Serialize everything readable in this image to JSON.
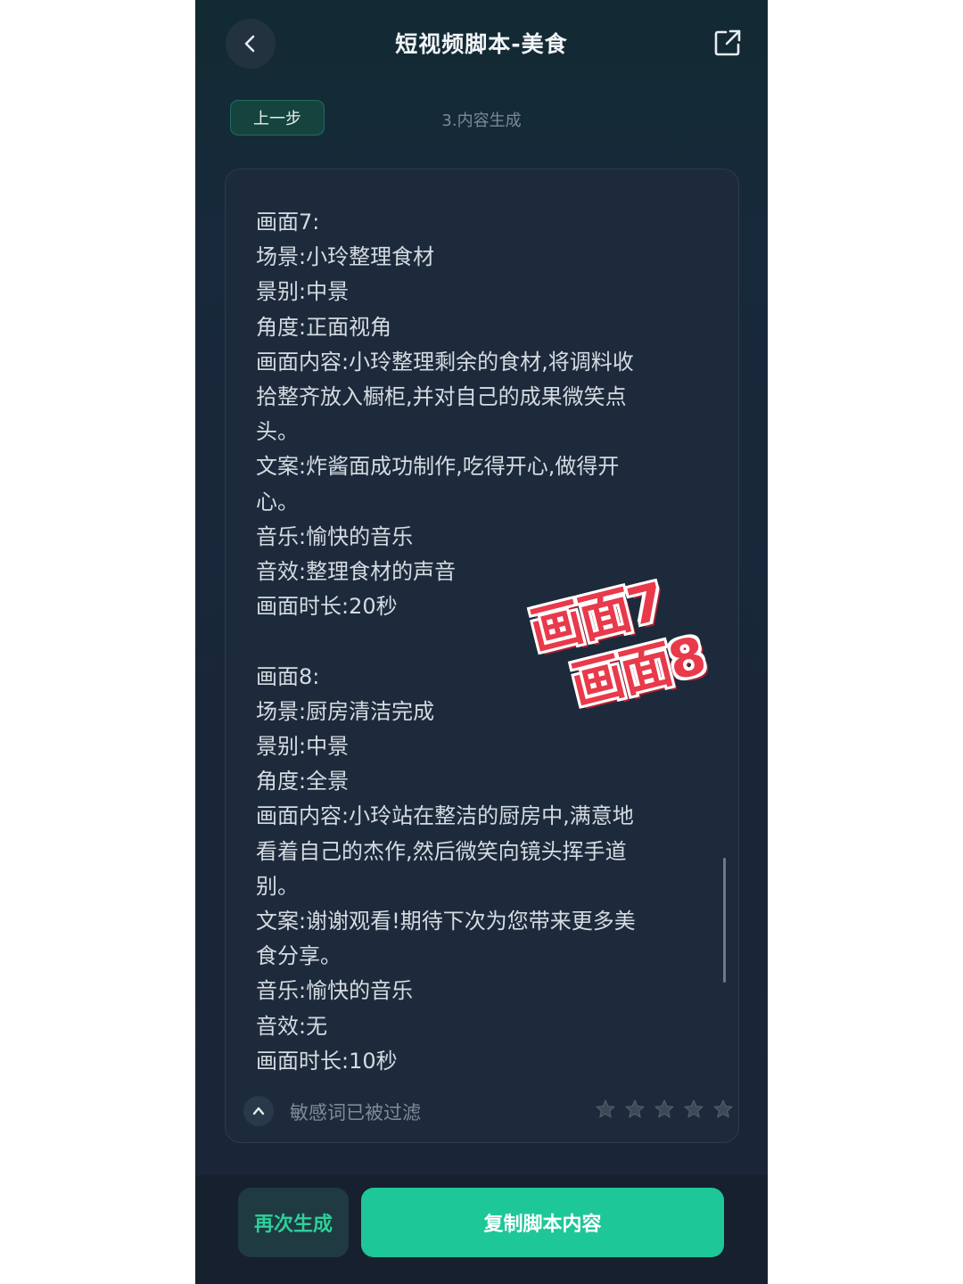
{
  "header": {
    "title": "短视频脚本-美食",
    "back_icon": "chevron-left-icon",
    "share_icon": "share-external-icon"
  },
  "step": {
    "prev_label": "上一步",
    "current": "3.内容生成"
  },
  "script": {
    "lines": [
      "画面7:",
      "场景:小玲整理食材",
      "景别:中景",
      "角度:正面视角",
      "画面内容:小玲整理剩余的食材,将调料收",
      "拾整齐放入橱柜,并对自己的成果微笑点",
      "头。",
      "文案:炸酱面成功制作,吃得开心,做得开",
      "心。",
      "音乐:愉快的音乐",
      "音效:整理食材的声音",
      "画面时长:20秒",
      "",
      "画面8:",
      "场景:厨房清洁完成",
      "景别:中景",
      "角度:全景",
      "画面内容:小玲站在整洁的厨房中,满意地",
      "看着自己的杰作,然后微笑向镜头挥手道",
      "别。",
      "文案:谢谢观看!期待下次为您带来更多美",
      "食分享。",
      "音乐:愉快的音乐",
      "音效:无",
      "画面时长:10秒"
    ]
  },
  "sticker": {
    "line1": "画面7",
    "line2": "画面8"
  },
  "footer": {
    "filter_text": "敏感词已被过滤",
    "collapse_icon": "chevron-up-icon",
    "rating_max": 5,
    "rating_value": 0
  },
  "actions": {
    "regenerate": "再次生成",
    "copy": "复制脚本内容"
  },
  "colors": {
    "accent": "#1ec797",
    "accent_text": "#2ecf9a",
    "sticker": "#e83a4a",
    "background": "#192638"
  }
}
